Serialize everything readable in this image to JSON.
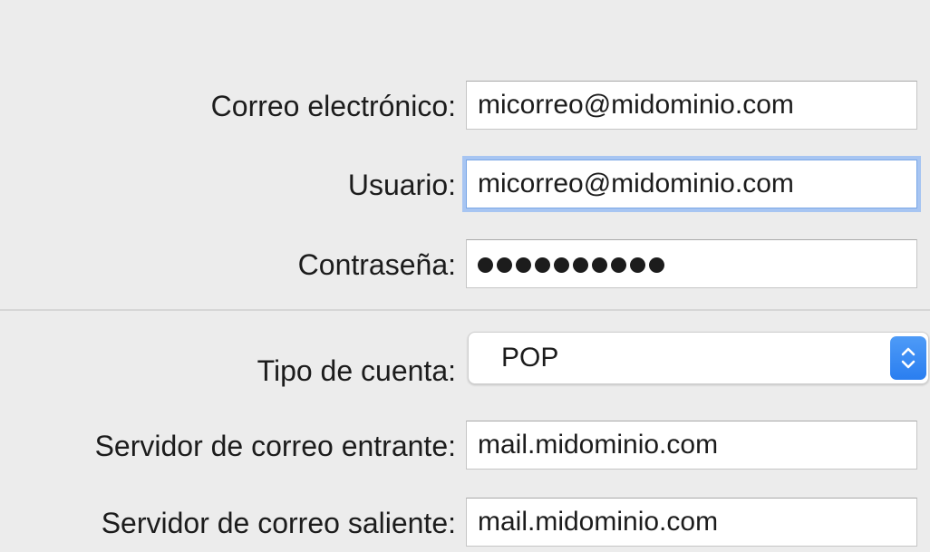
{
  "form": {
    "email": {
      "label": "Correo electrónico:",
      "value": "micorreo@midominio.com"
    },
    "user": {
      "label": "Usuario:",
      "value": "micorreo@midominio.com"
    },
    "password": {
      "label": "Contraseña:",
      "masked_char_count": 10
    },
    "account_type": {
      "label": "Tipo de cuenta:",
      "value": "POP"
    },
    "incoming_server": {
      "label": "Servidor de correo entrante:",
      "value": "mail.midominio.com"
    },
    "outgoing_server": {
      "label": "Servidor de correo saliente:",
      "value": "mail.midominio.com"
    }
  },
  "icons": {
    "account_type_stepper": "chevron-up-down-icon"
  },
  "colors": {
    "focus_ring": "#a7c5f2",
    "stepper_accent": "#2a7ef0"
  }
}
